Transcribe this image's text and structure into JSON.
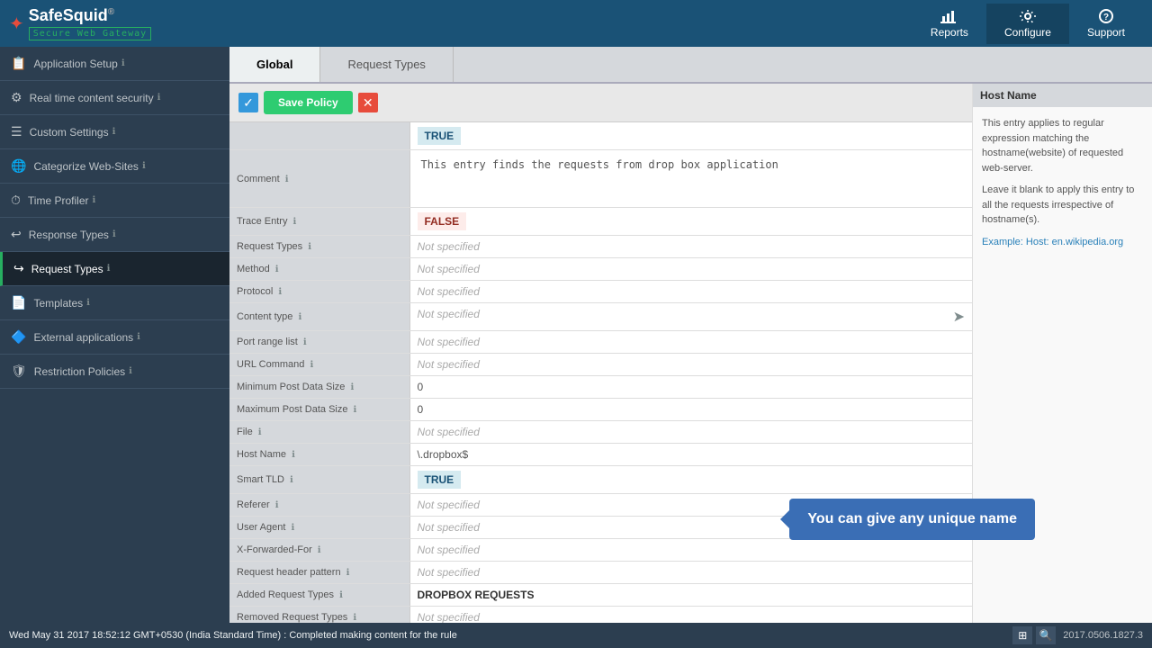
{
  "header": {
    "logo_name": "SafeSquid",
    "logo_reg": "®",
    "logo_sub": "Secure Web Gateway",
    "star": "✦"
  },
  "nav": {
    "reports": "Reports",
    "configure": "Configure",
    "support": "Support"
  },
  "sidebar": {
    "items": [
      {
        "id": "application-setup",
        "icon": "📋",
        "label": "Application Setup"
      },
      {
        "id": "real-time-content",
        "icon": "⚙",
        "label": "Real time content security"
      },
      {
        "id": "custom-settings",
        "icon": "☰",
        "label": "Custom Settings"
      },
      {
        "id": "categorize-websites",
        "icon": "🌐",
        "label": "Categorize Web-Sites"
      },
      {
        "id": "time-profiler",
        "icon": "⏱",
        "label": "Time Profiler"
      },
      {
        "id": "response-types",
        "icon": "↩",
        "label": "Response Types"
      },
      {
        "id": "request-types",
        "icon": "↪",
        "label": "Request Types",
        "active": true
      },
      {
        "id": "templates",
        "icon": "📄",
        "label": "Templates"
      },
      {
        "id": "external-applications",
        "icon": "🔷",
        "label": "External applications"
      },
      {
        "id": "restriction-policies",
        "icon": "🛡",
        "label": "Restriction Policies"
      }
    ]
  },
  "tabs": [
    {
      "id": "global",
      "label": "Global",
      "active": true
    },
    {
      "id": "request-types",
      "label": "Request Types"
    }
  ],
  "toolbar": {
    "save_label": "Save Policy"
  },
  "fields": [
    {
      "label": "Comment",
      "value": "This entry finds the requests from drop box application",
      "type": "textarea"
    },
    {
      "label": "Trace Entry",
      "value": "FALSE",
      "type": "boolean-false"
    },
    {
      "label": "Request Types",
      "value": "Not specified",
      "type": "not-specified"
    },
    {
      "label": "Method",
      "value": "Not specified",
      "type": "not-specified"
    },
    {
      "label": "Protocol",
      "value": "Not specified",
      "type": "not-specified"
    },
    {
      "label": "Content type",
      "value": "Not specified",
      "type": "not-specified"
    },
    {
      "label": "Port range list",
      "value": "Not specified",
      "type": "not-specified"
    },
    {
      "label": "URL Command",
      "value": "Not specified",
      "type": "not-specified"
    },
    {
      "label": "Minimum Post Data Size",
      "value": "0",
      "type": "text"
    },
    {
      "label": "Maximum Post Data Size",
      "value": "0",
      "type": "text"
    },
    {
      "label": "File",
      "value": "Not specified",
      "type": "not-specified"
    },
    {
      "label": "Host Name",
      "value": "\\.dropbox$",
      "type": "text"
    },
    {
      "label": "Smart TLD",
      "value": "TRUE",
      "type": "boolean-true"
    },
    {
      "label": "Referer",
      "value": "Not specified",
      "type": "not-specified"
    },
    {
      "label": "User Agent",
      "value": "Not specified",
      "type": "not-specified"
    },
    {
      "label": "X-Forwarded-For",
      "value": "Not specified",
      "type": "not-specified"
    },
    {
      "label": "Request header pattern",
      "value": "Not specified",
      "type": "not-specified"
    },
    {
      "label": "Added Request Types",
      "value": "DROPBOX REQUESTS",
      "type": "text-bold"
    },
    {
      "label": "Removed Request Types",
      "value": "Not specified",
      "type": "not-specified"
    }
  ],
  "entry_status": "TRUE",
  "right_panel": {
    "title": "Host Name",
    "text1": "This entry applies to regular expression matching the hostname(website) of requested web-server.",
    "text2": "Leave it blank to apply this entry to all the requests irrespective of hostname(s).",
    "example_label": "Example:",
    "example_value": "Host: en.wikipedia.org"
  },
  "tooltip": {
    "text": "You can give any unique name"
  },
  "status_bar": {
    "message": "Wed May 31 2017 18:52:12 GMT+0530 (India Standard Time) : Completed making content for the rule",
    "version": "2017.0506.1827.3"
  }
}
